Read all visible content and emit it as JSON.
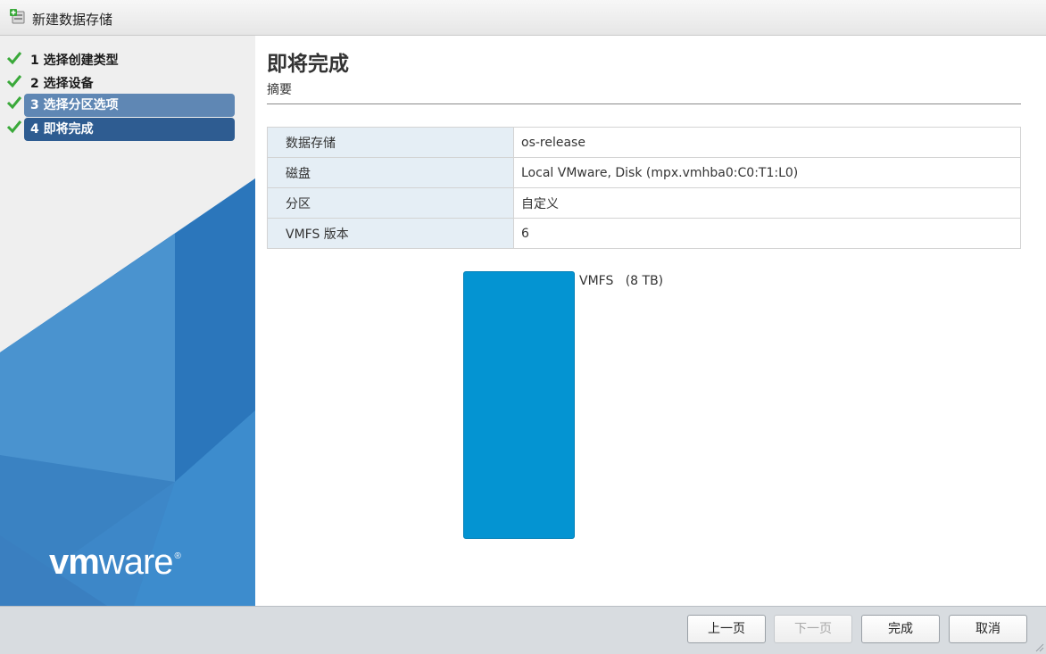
{
  "window": {
    "title": "新建数据存储"
  },
  "sidebar": {
    "steps": [
      {
        "label": "1 选择创建类型",
        "status": "complete"
      },
      {
        "label": "2 选择设备",
        "status": "complete"
      },
      {
        "label": "3 选择分区选项",
        "status": "complete"
      },
      {
        "label": "4 即将完成",
        "status": "current"
      }
    ],
    "logo": {
      "part1": "vm",
      "part2": "ware",
      "mark": "®"
    }
  },
  "main": {
    "title": "即将完成",
    "subtitle": "摘要",
    "summary": [
      {
        "key": "数据存储",
        "value": "os-release"
      },
      {
        "key": "磁盘",
        "value": "Local VMware, Disk (mpx.vmhba0:C0:T1:L0)"
      },
      {
        "key": "分区",
        "value": "自定义"
      },
      {
        "key": "VMFS 版本",
        "value": "6"
      }
    ],
    "partition": {
      "label": "VMFS   (8 TB)",
      "color": "#0494d2"
    }
  },
  "footer": {
    "back_label": "上一页",
    "next_label": "下一页",
    "finish_label": "完成",
    "cancel_label": "取消"
  },
  "colors": {
    "active_step": "#2e5c91",
    "completed_step": "#5f87b4",
    "check": "#3aa93a"
  }
}
